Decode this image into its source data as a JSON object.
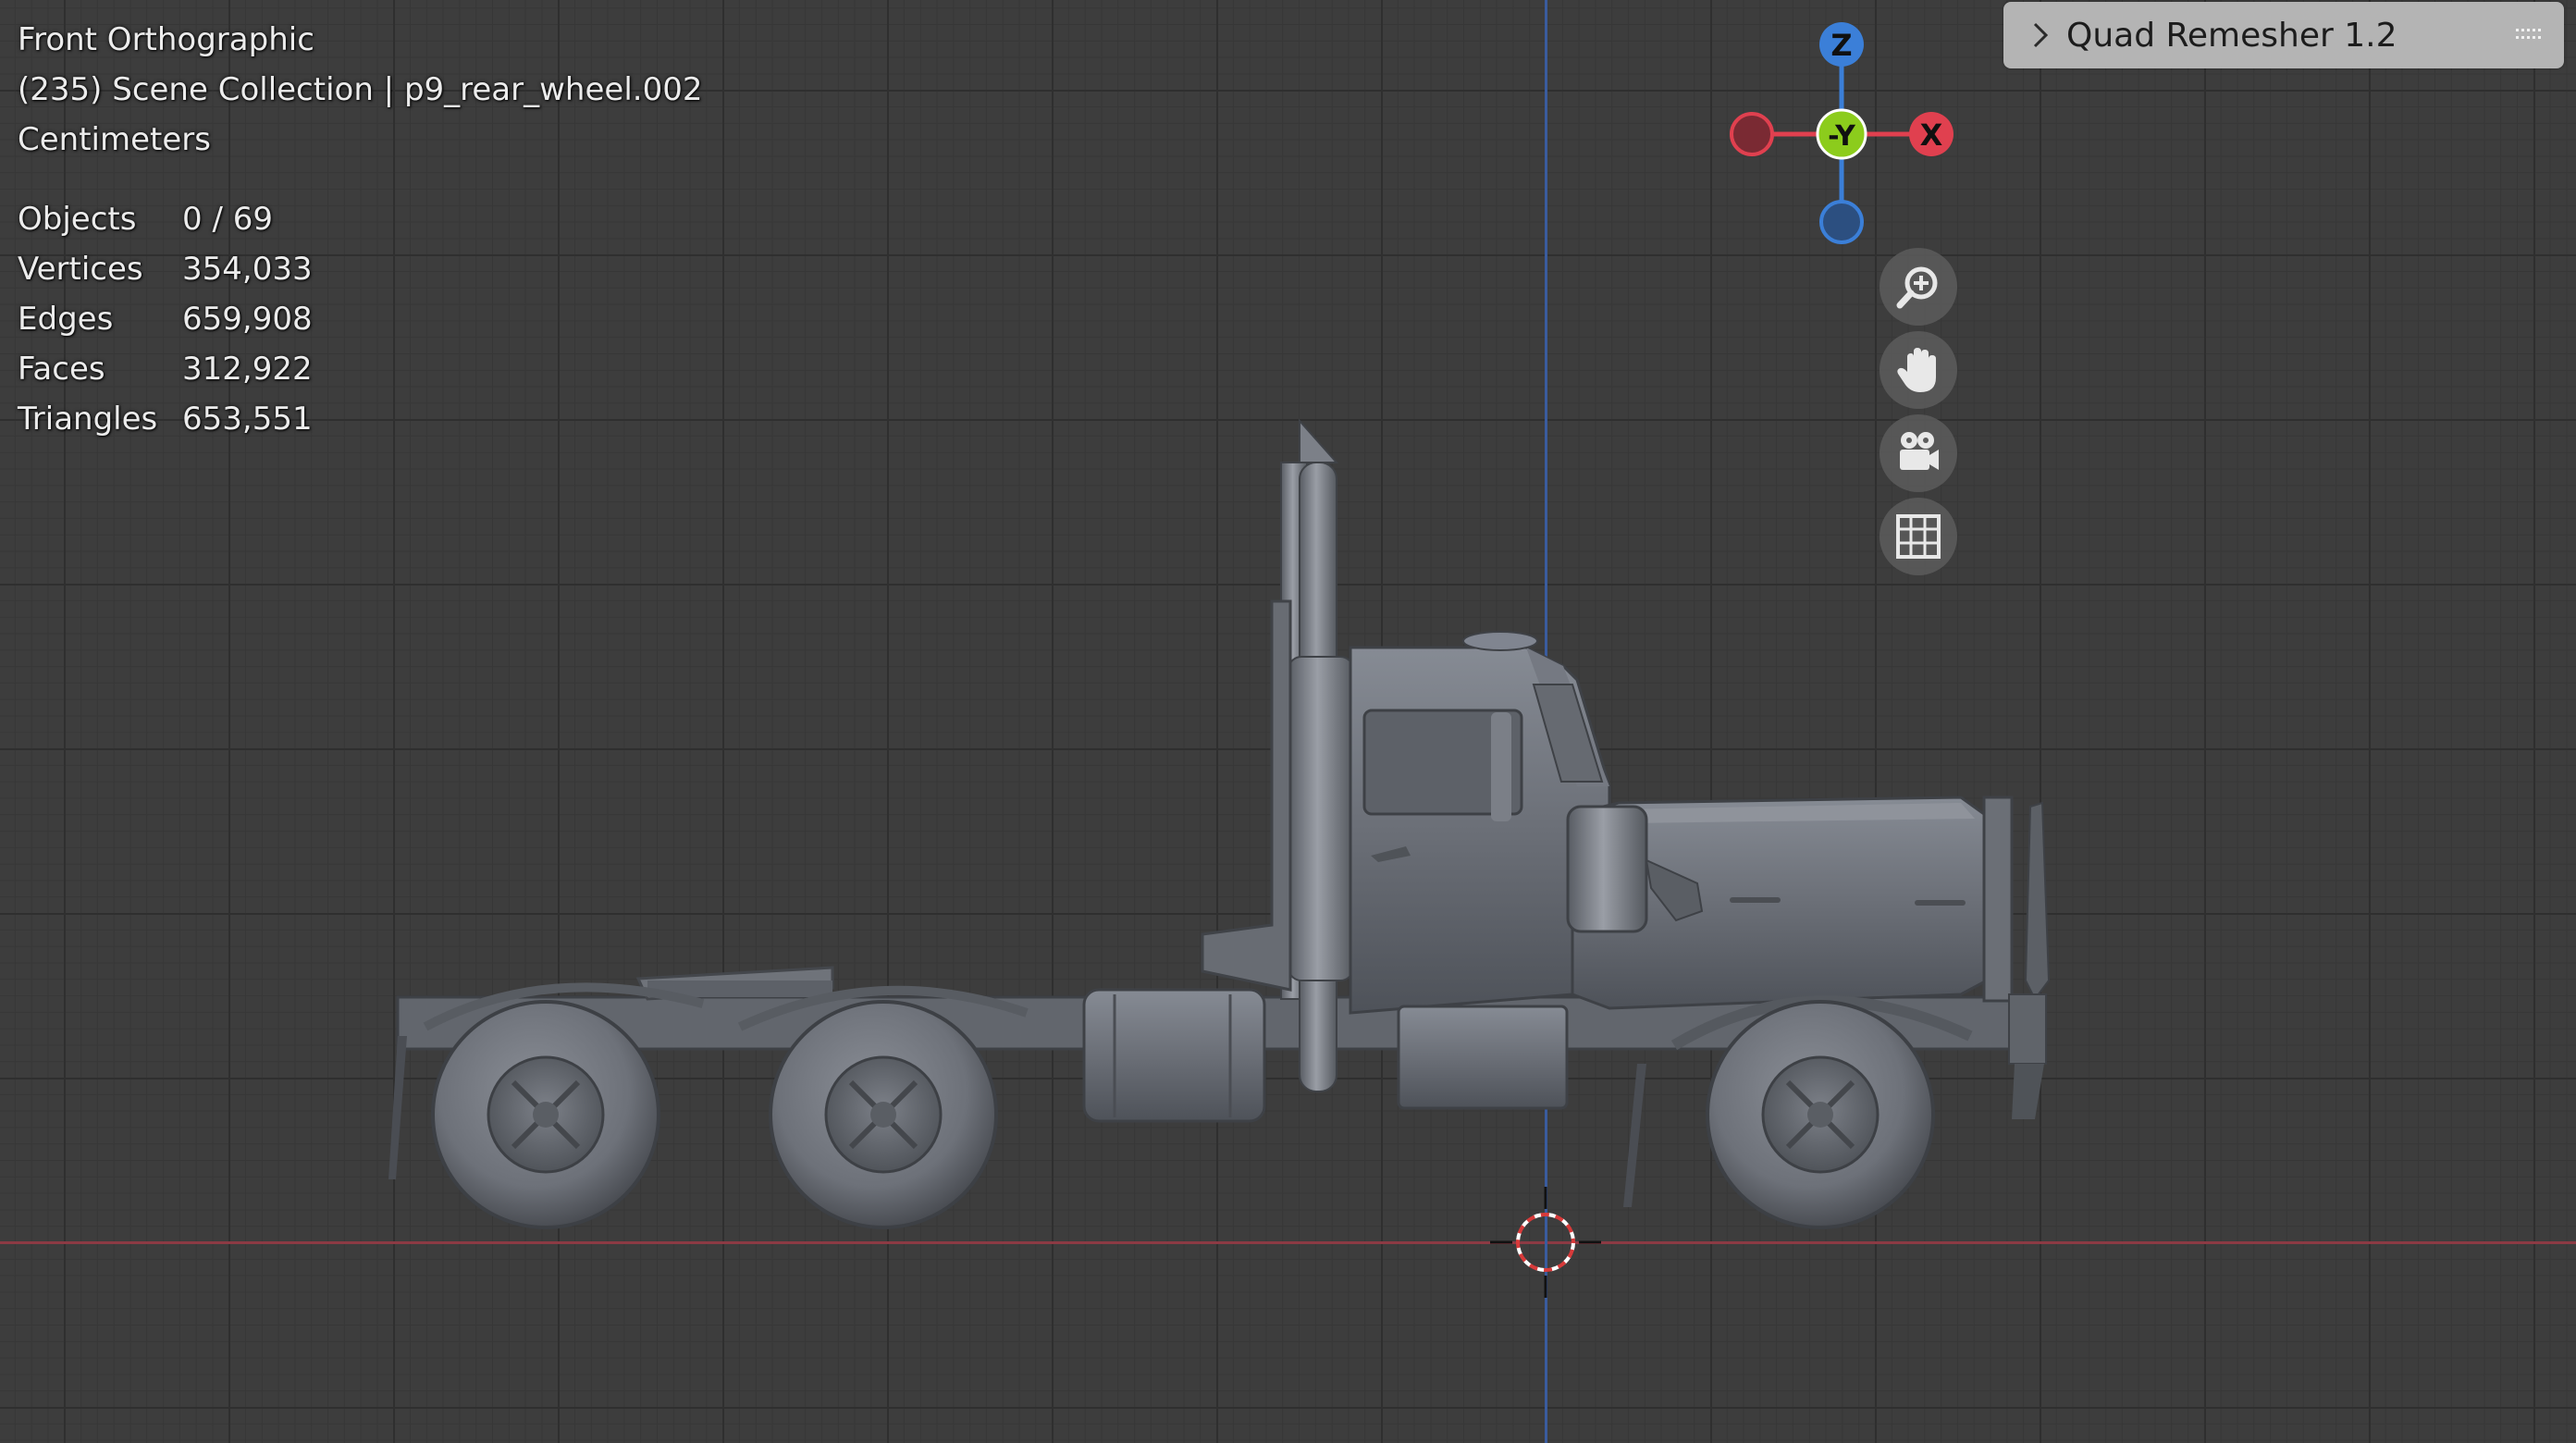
{
  "view": {
    "name": "Front Orthographic",
    "collection": "(235) Scene Collection | p9_rear_wheel.002",
    "units": "Centimeters"
  },
  "stats": [
    {
      "label": "Objects",
      "value": "0 / 69"
    },
    {
      "label": "Vertices",
      "value": "354,033"
    },
    {
      "label": "Edges",
      "value": "659,908"
    },
    {
      "label": "Faces",
      "value": "312,922"
    },
    {
      "label": "Triangles",
      "value": "653,551"
    }
  ],
  "gizmo": {
    "z_label": "Z",
    "y_label": "-Y",
    "x_label": "X",
    "colors": {
      "x": "#e0404f",
      "y": "#8ccc1c",
      "z": "#3b7fd8"
    }
  },
  "nav_icons": [
    "zoom-icon",
    "hand-pan-icon",
    "camera-icon",
    "grid-icon"
  ],
  "panel": {
    "title": "Quad Remesher 1.2"
  }
}
